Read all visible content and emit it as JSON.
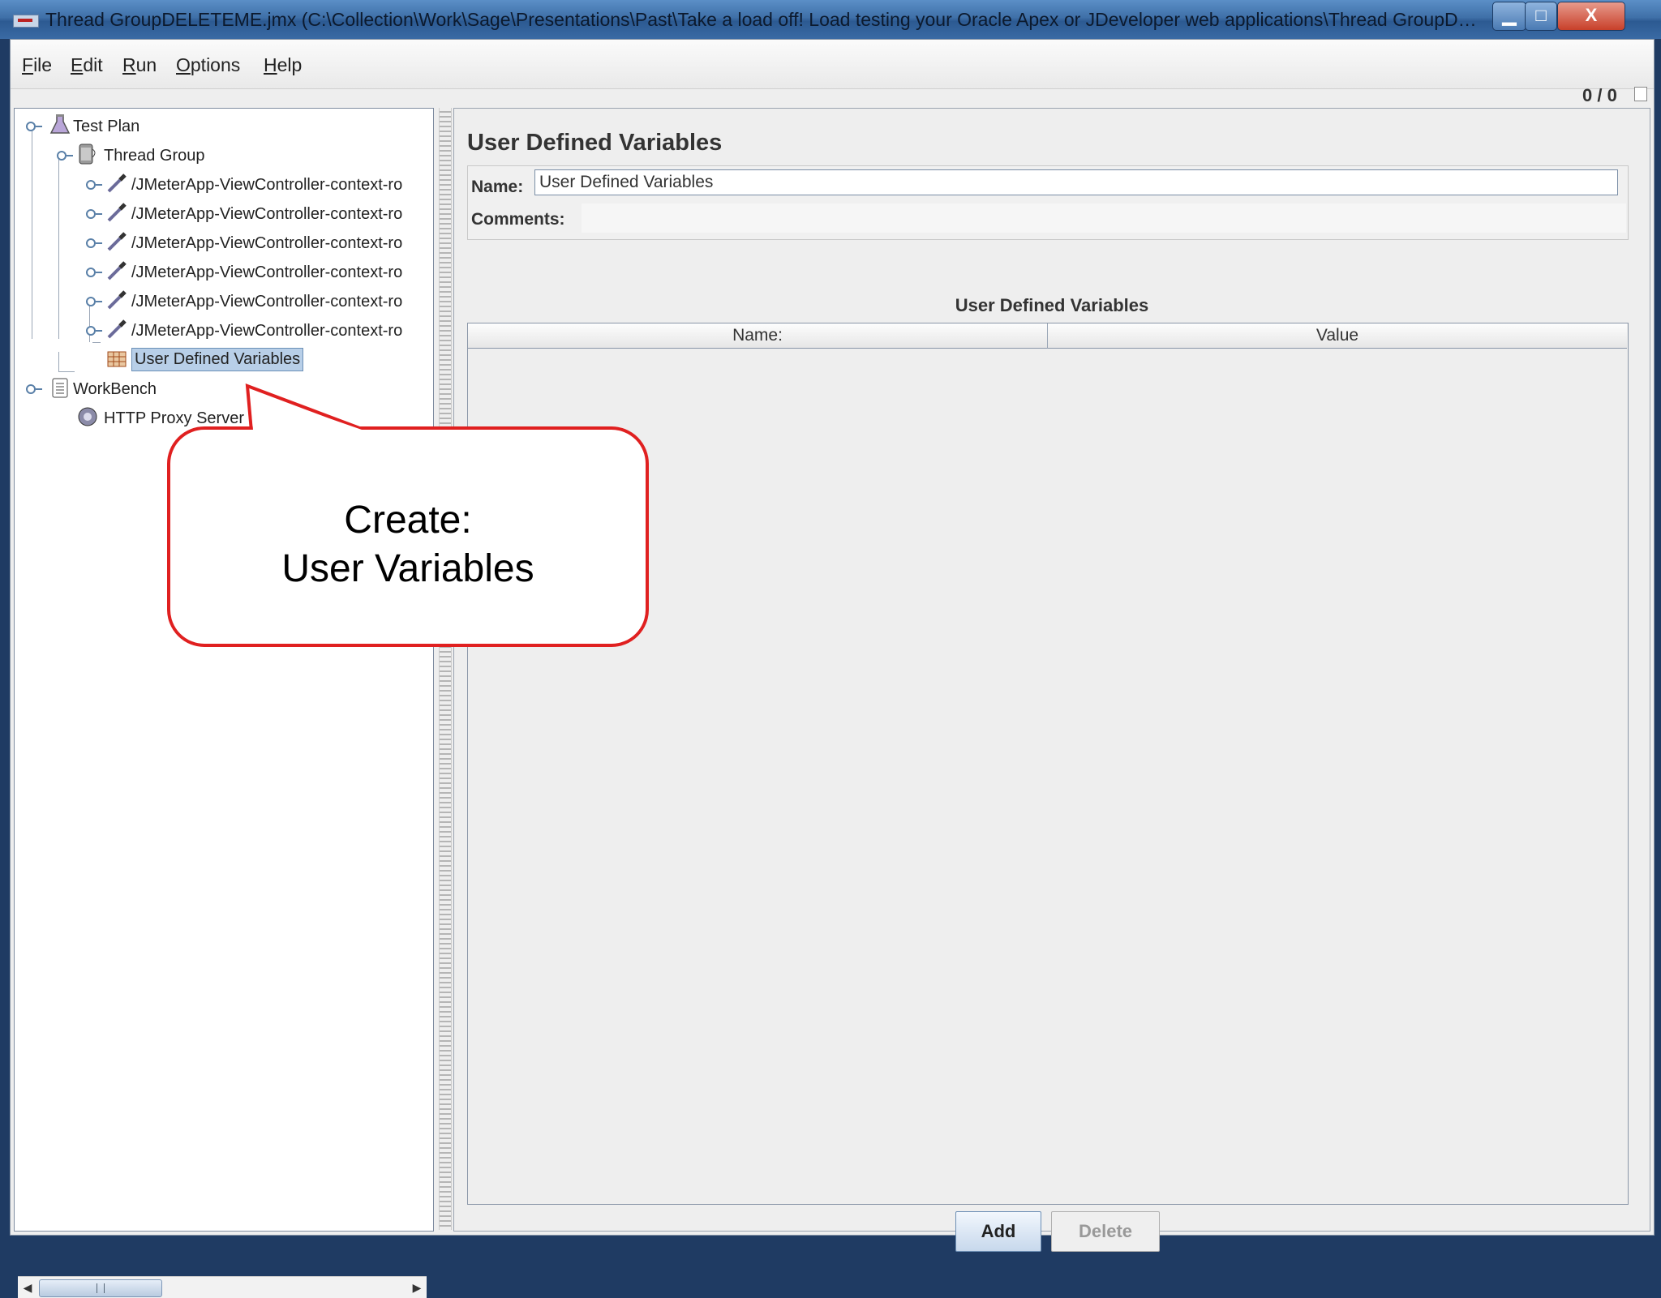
{
  "window": {
    "title": "Thread GroupDELETEME.jmx (C:\\Collection\\Work\\Sage\\Presentations\\Past\\Take a load off!  Load testing your Oracle Apex or JDeveloper web applications\\Thread GroupDEL...",
    "minimize_glyph": "▁",
    "maximize_glyph": "□",
    "close_glyph": "X"
  },
  "menu": [
    "File",
    "Edit",
    "Run",
    "Options",
    "Help"
  ],
  "status_counter": "0 / 0",
  "tree": {
    "test_plan": "Test Plan",
    "thread_group": "Thread Group",
    "samplers": [
      "/JMeterApp-ViewController-context-ro",
      "/JMeterApp-ViewController-context-ro",
      "/JMeterApp-ViewController-context-ro",
      "/JMeterApp-ViewController-context-ro",
      "/JMeterApp-ViewController-context-ro",
      "/JMeterApp-ViewController-context-ro"
    ],
    "selected": "User Defined Variables",
    "workbench": "WorkBench",
    "proxy": "HTTP Proxy Server"
  },
  "panel": {
    "title": "User Defined Variables",
    "name_label": "Name:",
    "name_value": "User Defined Variables",
    "comments_label": "Comments:",
    "table_caption": "User Defined Variables",
    "columns": [
      "Name:",
      "Value"
    ],
    "add_label": "Add",
    "delete_label": "Delete"
  },
  "callout": {
    "line1": "Create:",
    "line2": "User Variables"
  },
  "colors": {
    "callout_border": "#e02020",
    "selection": "#b8cfe8",
    "titlebar": "#3f70a8"
  }
}
